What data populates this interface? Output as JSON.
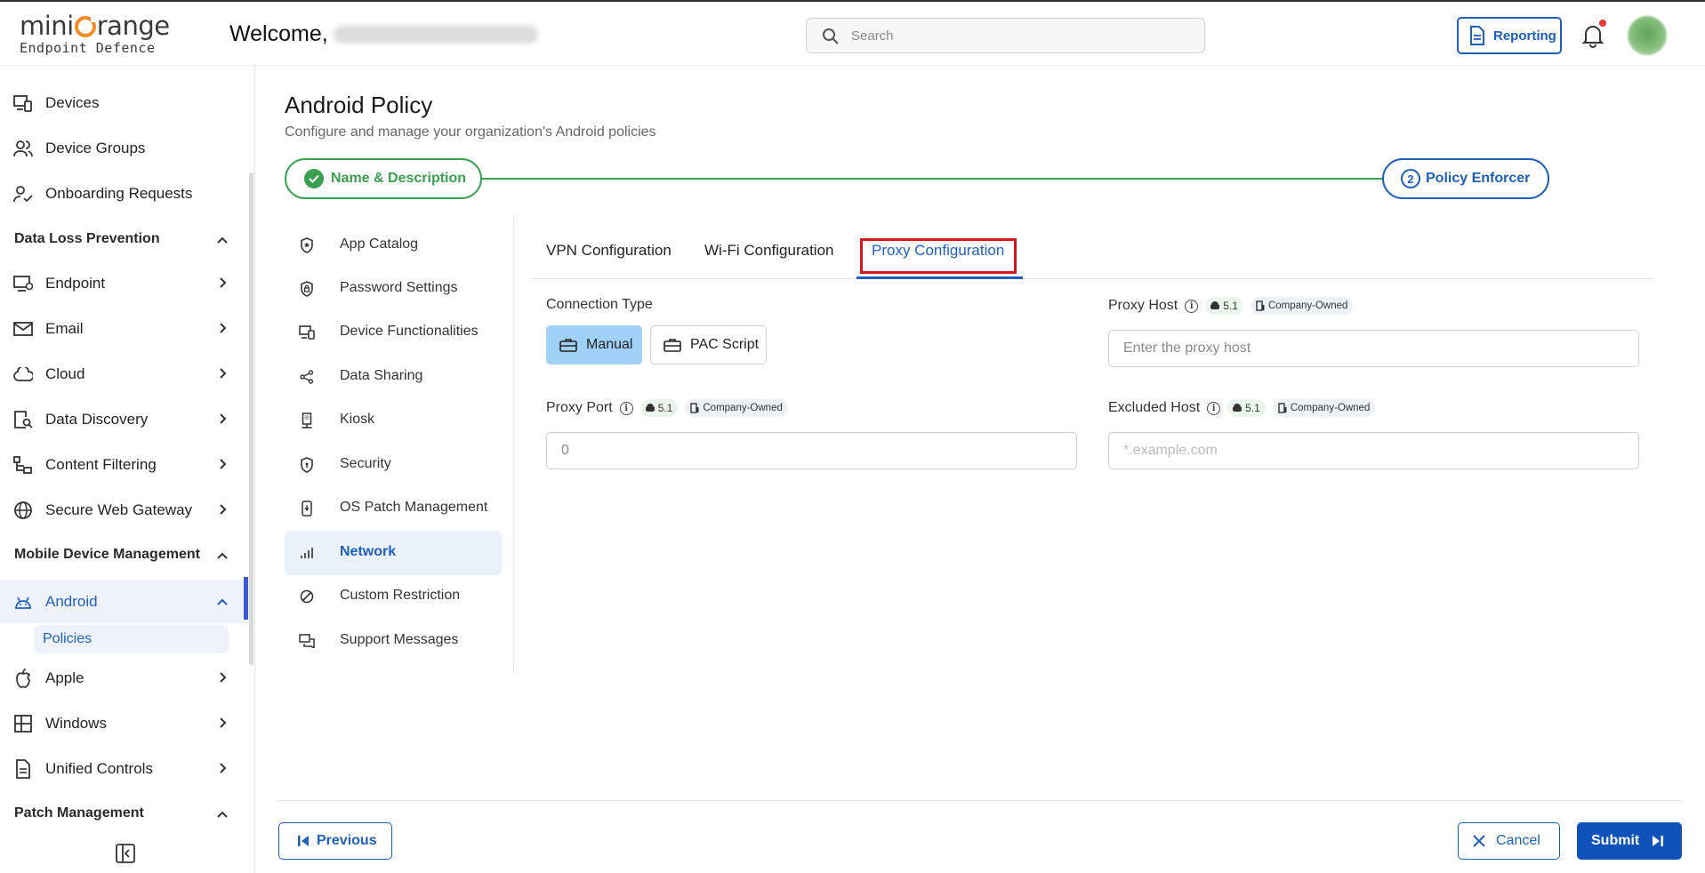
{
  "header": {
    "logo_main_pre": "mini",
    "logo_main_post": "range",
    "logo_sub": "Endpoint Defence",
    "welcome": "Welcome,",
    "search_placeholder": "Search",
    "reporting_label": "Reporting",
    "notification_dot_color": "#e53935"
  },
  "sidebar": {
    "items_top": [
      {
        "label": "Devices",
        "icon": "devices-icon"
      },
      {
        "label": "Device Groups",
        "icon": "users-icon"
      },
      {
        "label": "Onboarding Requests",
        "icon": "user-check-icon"
      }
    ],
    "section_dlp": "Data Loss Prevention",
    "dlp_items": [
      {
        "label": "Endpoint",
        "icon": "monitor-icon"
      },
      {
        "label": "Email",
        "icon": "mail-icon"
      },
      {
        "label": "Cloud",
        "icon": "cloud-icon"
      },
      {
        "label": "Data Discovery",
        "icon": "data-discovery-icon"
      },
      {
        "label": "Content Filtering",
        "icon": "content-filter-icon"
      },
      {
        "label": "Secure Web Gateway",
        "icon": "globe-icon"
      }
    ],
    "section_mdm": "Mobile Device Management",
    "mdm_items": [
      {
        "label": "Android",
        "icon": "android-icon"
      },
      {
        "label": "Apple",
        "icon": "apple-icon"
      },
      {
        "label": "Windows",
        "icon": "windows-icon"
      },
      {
        "label": "Unified Controls",
        "icon": "document-icon"
      }
    ],
    "android_sub": "Policies",
    "section_patch": "Patch Management"
  },
  "page": {
    "title": "Android Policy",
    "subtitle": "Configure and manage your organization's Android policies"
  },
  "stepper": {
    "step1_label": "Name & Description",
    "step2_number": "2",
    "step2_label": "Policy Enforcer"
  },
  "policy_menu": [
    {
      "label": "App Catalog",
      "icon": "shield-star-icon"
    },
    {
      "label": "Password Settings",
      "icon": "shield-lock-icon"
    },
    {
      "label": "Device Functionalities",
      "icon": "device-functions-icon"
    },
    {
      "label": "Data Sharing",
      "icon": "share-icon"
    },
    {
      "label": "Kiosk",
      "icon": "kiosk-icon"
    },
    {
      "label": "Security",
      "icon": "shield-icon"
    },
    {
      "label": "OS Patch Management",
      "icon": "patch-icon"
    },
    {
      "label": "Network",
      "icon": "signal-icon"
    },
    {
      "label": "Custom Restriction",
      "icon": "block-icon"
    },
    {
      "label": "Support Messages",
      "icon": "message-icon"
    }
  ],
  "active_policy": "Network",
  "tabs": [
    "VPN Configuration",
    "Wi-Fi Configuration",
    "Proxy Configuration"
  ],
  "active_tab": "Proxy Configuration",
  "form": {
    "connection_type_label": "Connection Type",
    "conn_manual": "Manual",
    "conn_pac": "PAC Script",
    "proxy_host_label": "Proxy Host",
    "proxy_host_placeholder": "Enter the proxy host",
    "proxy_port_label": "Proxy Port",
    "proxy_port_placeholder": "0",
    "excluded_host_label": "Excluded Host",
    "excluded_host_placeholder": "*.example.com",
    "android_version": "5.1",
    "ownership_chip": "Company-Owned",
    "info_glyph": "i"
  },
  "footer": {
    "previous": "Previous",
    "cancel": "Cancel",
    "submit": "Submit"
  },
  "colors": {
    "primary": "#1e5fb8",
    "success": "#3aa04f",
    "highlight": "#d9141e",
    "manual_bg": "#9fd0f5"
  }
}
